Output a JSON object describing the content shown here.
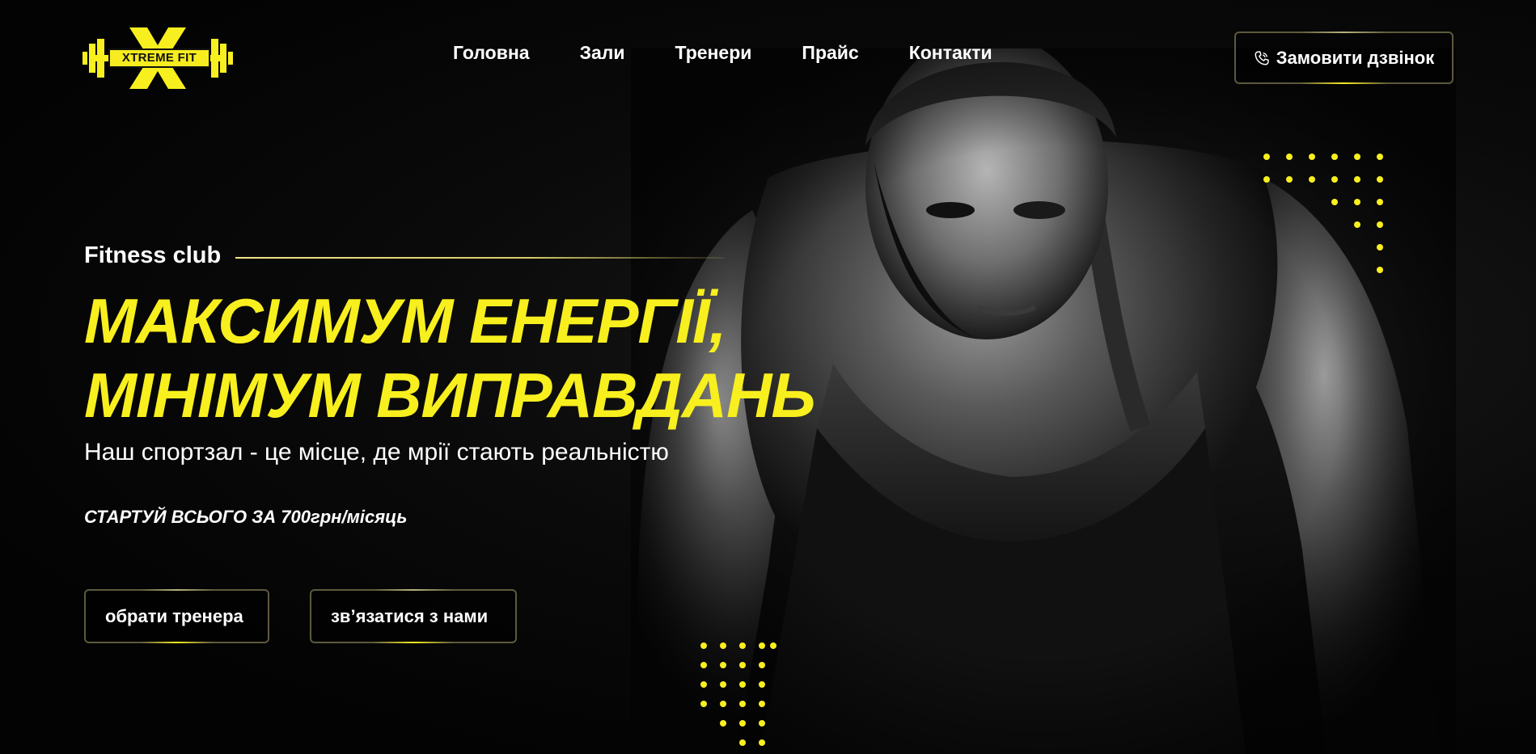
{
  "brand": {
    "logo_text": "XTREME FIT",
    "accent_color": "#f8ef1e"
  },
  "nav": {
    "items": [
      {
        "label": "Головна"
      },
      {
        "label": "Зали"
      },
      {
        "label": "Тренери"
      },
      {
        "label": "Прайс"
      },
      {
        "label": "Контакти"
      }
    ],
    "call_button": {
      "label": "Замовити дзвінок",
      "icon": "phone-icon"
    }
  },
  "hero": {
    "eyebrow": "Fitness club",
    "headline_line1": "МАКСИМУМ ЕНЕРГІЇ,",
    "headline_line2": "МІНІМУМ ВИПРАВДАНЬ",
    "subheadline": "Наш спортзал - це місце, де мрії стають реальністю",
    "promo": "СТАРТУЙ ВСЬОГО ЗА 700грн/місяць",
    "buttons": {
      "trainer": "обрати тренера",
      "contact": "зв’язатися з нами"
    }
  }
}
